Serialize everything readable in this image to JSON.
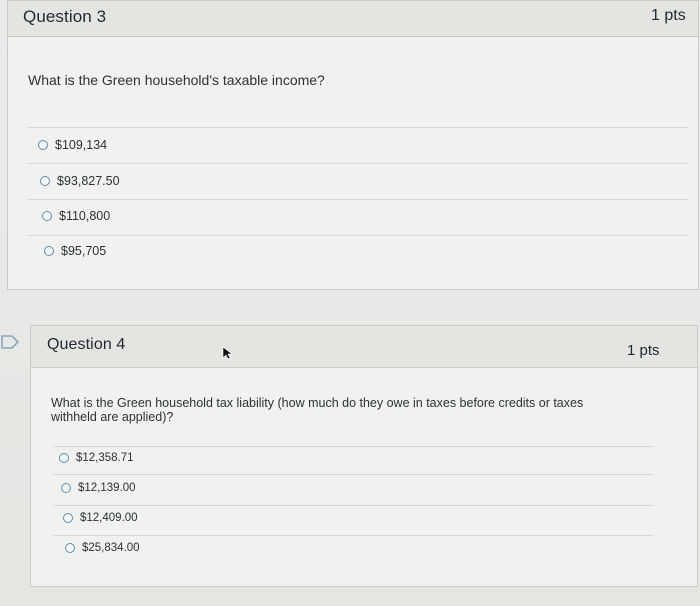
{
  "questions": [
    {
      "title": "Question 3",
      "points": "1 pts",
      "text": "What is the Green household's taxable income?",
      "answers": [
        "$109,134",
        "$93,827.50",
        "$110,800",
        "$95,705"
      ]
    },
    {
      "title": "Question 4",
      "points": "1 pts",
      "text_line1": "What is the Green household tax liability (how much do they owe in taxes before credits or taxes",
      "text_line2": "withheld are applied)?",
      "answers": [
        "$12,358.71",
        "$12,139.00",
        "$12,409.00",
        "$25,834.00"
      ]
    }
  ],
  "icons": {
    "flag": "flag-question-icon",
    "cursor": "mouse-pointer-icon"
  },
  "colors": {
    "radio_border": "#5c8fb3",
    "header_bg": "#e4e4e1",
    "card_bg": "#f1f1ef"
  }
}
